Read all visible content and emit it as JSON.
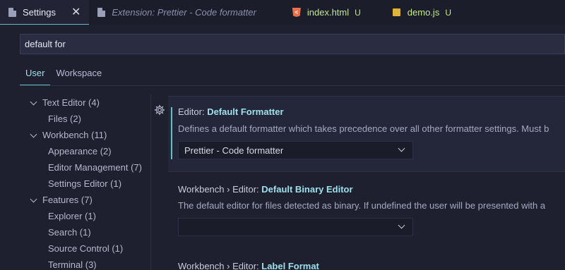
{
  "tabs": [
    {
      "label": "Settings",
      "icon": "settings-doc-icon",
      "close": "✕"
    },
    {
      "label": "Extension: Prettier - Code formatter",
      "icon": "extension-doc-icon"
    },
    {
      "label": "index.html",
      "icon": "html-file-icon",
      "badge": "U"
    },
    {
      "label": "demo.js",
      "icon": "js-file-icon",
      "badge": "U"
    }
  ],
  "search": {
    "value": "default for"
  },
  "scopes": [
    "User",
    "Workspace"
  ],
  "toc": [
    {
      "label": "Text Editor (4)",
      "level": 1
    },
    {
      "label": "Files (2)",
      "level": 2
    },
    {
      "label": "Workbench (11)",
      "level": 1
    },
    {
      "label": "Appearance (2)",
      "level": 2
    },
    {
      "label": "Editor Management (7)",
      "level": 2
    },
    {
      "label": "Settings Editor (1)",
      "level": 2
    },
    {
      "label": "Features (7)",
      "level": 1
    },
    {
      "label": "Explorer (1)",
      "level": 2
    },
    {
      "label": "Search (1)",
      "level": 2
    },
    {
      "label": "Source Control (1)",
      "level": 2
    },
    {
      "label": "Terminal (3)",
      "level": 2
    }
  ],
  "settings": [
    {
      "prefix": "Editor: ",
      "name": "Default Formatter",
      "description": "Defines a default formatter which takes precedence over all other formatter settings. Must b",
      "value": "Prettier - Code formatter"
    },
    {
      "prefix": "Workbench › Editor: ",
      "name": "Default Binary Editor",
      "description": "The default editor for files detected as binary. If undefined the user will be presented with a",
      "value": ""
    },
    {
      "prefix": "Workbench › Editor: ",
      "name": "Label Format"
    }
  ],
  "colors": {
    "accent": "#65bcc6",
    "title_highlight": "#9ee0ea",
    "untracked": "#c3e88d",
    "background": "#1e2030"
  }
}
